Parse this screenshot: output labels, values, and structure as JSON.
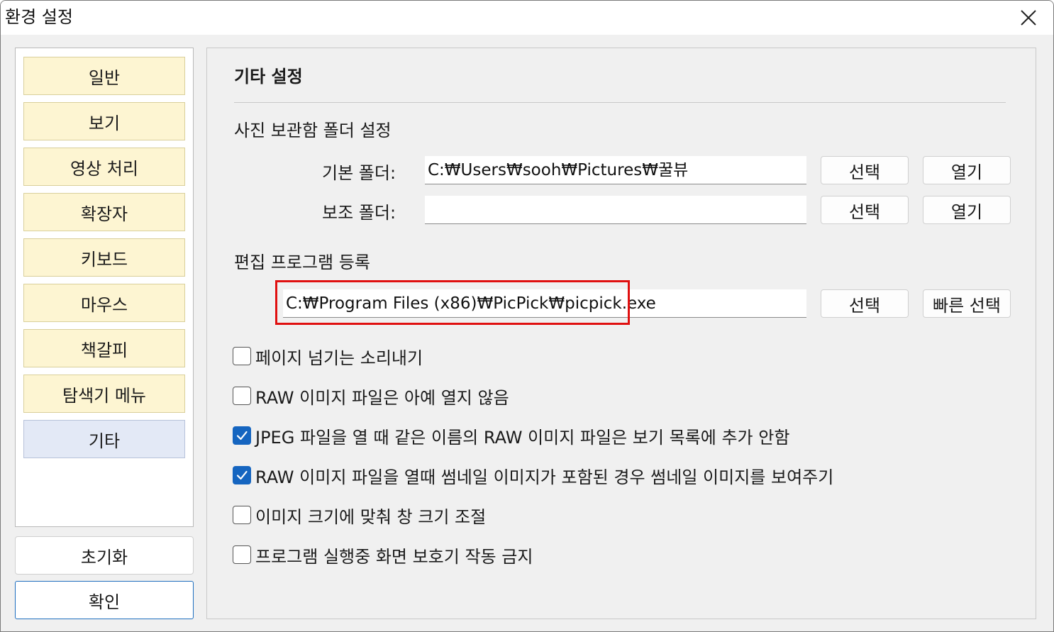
{
  "window": {
    "title": "환경 설정"
  },
  "sidebar": {
    "items": [
      {
        "label": "일반",
        "selected": false
      },
      {
        "label": "보기",
        "selected": false
      },
      {
        "label": "영상 처리",
        "selected": false
      },
      {
        "label": "확장자",
        "selected": false
      },
      {
        "label": "키보드",
        "selected": false
      },
      {
        "label": "마우스",
        "selected": false
      },
      {
        "label": "책갈피",
        "selected": false
      },
      {
        "label": "탐색기 메뉴",
        "selected": false
      },
      {
        "label": "기타",
        "selected": true
      }
    ],
    "reset_label": "초기화",
    "ok_label": "확인"
  },
  "content": {
    "title": "기타 설정",
    "photo_folder": {
      "label": "사진 보관함 폴더 설정",
      "default_label": "기본 폴더:",
      "default_value": "C:₩Users₩sooh₩Pictures₩꿀뷰",
      "secondary_label": "보조 폴더:",
      "secondary_value": "",
      "select_label": "선택",
      "open_label": "열기"
    },
    "editor": {
      "label": "편집 프로그램 등록",
      "value": "C:₩Program Files (x86)₩PicPick₩picpick.exe",
      "select_label": "선택",
      "quick_select_label": "빠른 선택"
    },
    "options": [
      {
        "label": "페이지 넘기는 소리내기",
        "checked": false
      },
      {
        "label": "RAW 이미지 파일은 아예 열지 않음",
        "checked": false
      },
      {
        "label": "JPEG 파일을 열 때 같은 이름의 RAW 이미지 파일은 보기 목록에 추가 안함",
        "checked": true
      },
      {
        "label": "RAW 이미지 파일을 열때 썸네일 이미지가 포함된 경우 썸네일 이미지를 보여주기",
        "checked": true
      },
      {
        "label": "이미지 크기에 맞춰 창 크기 조절",
        "checked": false
      },
      {
        "label": "프로그램 실행중 화면 보호기 작동 금지",
        "checked": false
      }
    ]
  },
  "colors": {
    "accent": "#1565c0",
    "highlight": "#e01010",
    "nav_item": "#fdf5d2",
    "nav_selected": "#e3e9f6"
  }
}
